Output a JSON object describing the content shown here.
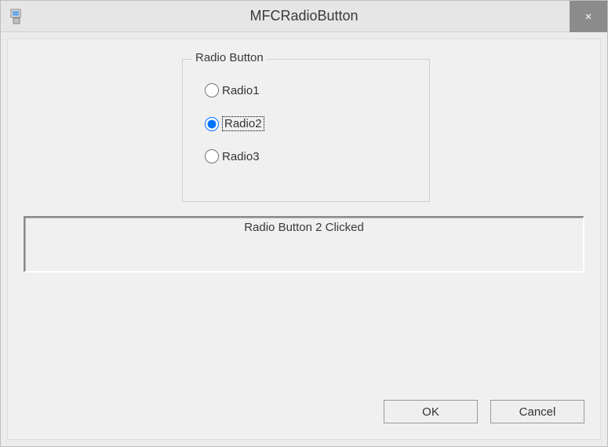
{
  "window": {
    "title": "MFCRadioButton",
    "close": "×"
  },
  "group": {
    "caption": "Radio Button",
    "options": [
      "Radio1",
      "Radio2",
      "Radio3"
    ],
    "selectedIndex": 1
  },
  "status": "Radio Button 2 Clicked",
  "buttons": {
    "ok": "OK",
    "cancel": "Cancel"
  }
}
